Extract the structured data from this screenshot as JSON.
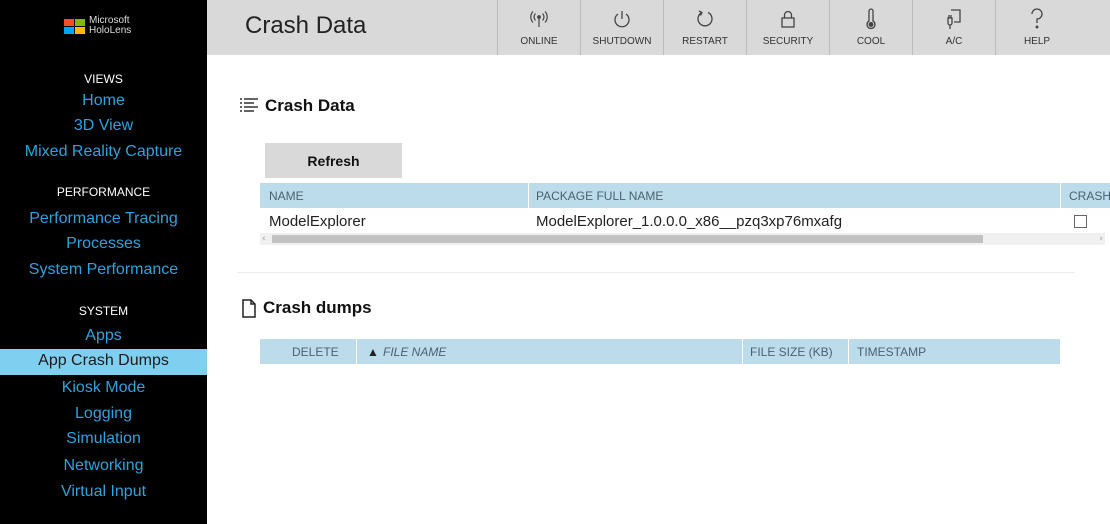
{
  "brand": {
    "line1": "Microsoft",
    "line2": "HoloLens",
    "logo_colors": [
      "#f25022",
      "#7fba00",
      "#00a4ef",
      "#ffb900"
    ]
  },
  "sidebar": {
    "sections": [
      {
        "title": "VIEWS",
        "items": [
          {
            "label": "Home"
          },
          {
            "label": "3D View"
          },
          {
            "label": "Mixed Reality Capture"
          }
        ]
      },
      {
        "title": "PERFORMANCE",
        "items": [
          {
            "label": "Performance Tracing"
          },
          {
            "label": "Processes"
          },
          {
            "label": "System Performance"
          }
        ]
      },
      {
        "title": "SYSTEM",
        "items": [
          {
            "label": "Apps"
          },
          {
            "label": "App Crash Dumps",
            "active": true
          },
          {
            "label": "Kiosk Mode"
          },
          {
            "label": "Logging"
          },
          {
            "label": "Simulation"
          },
          {
            "label": "Networking"
          },
          {
            "label": "Virtual Input"
          }
        ]
      }
    ]
  },
  "header": {
    "title": "Crash Data",
    "buttons": [
      {
        "label": "ONLINE",
        "icon": "wifi-signal-icon"
      },
      {
        "label": "SHUTDOWN",
        "icon": "power-icon"
      },
      {
        "label": "RESTART",
        "icon": "restart-icon"
      },
      {
        "label": "SECURITY",
        "icon": "lock-icon"
      },
      {
        "label": "COOL",
        "icon": "thermometer-icon"
      },
      {
        "label": "A/C",
        "icon": "plug-icon"
      },
      {
        "label": "HELP",
        "icon": "question-icon"
      }
    ]
  },
  "crash_data": {
    "heading": "Crash Data",
    "refresh_label": "Refresh",
    "columns": [
      "NAME",
      "PACKAGE FULL NAME",
      "CRASH"
    ],
    "rows": [
      {
        "name": "ModelExplorer",
        "package": "ModelExplorer_1.0.0.0_x86__pzq3xp76mxafg",
        "checked": false
      }
    ]
  },
  "crash_dumps": {
    "heading": "Crash dumps",
    "columns": [
      "DELETE",
      "FILE NAME",
      "FILE SIZE (KB)",
      "TIMESTAMP"
    ],
    "sort_indicator": "▲"
  },
  "colors": {
    "sidebar_bg": "#000000",
    "nav_link": "#2aa3df",
    "nav_active_bg": "#7fd0f0",
    "topbar_bg": "#d9d9d9",
    "table_header_bg": "#bcdcec"
  }
}
